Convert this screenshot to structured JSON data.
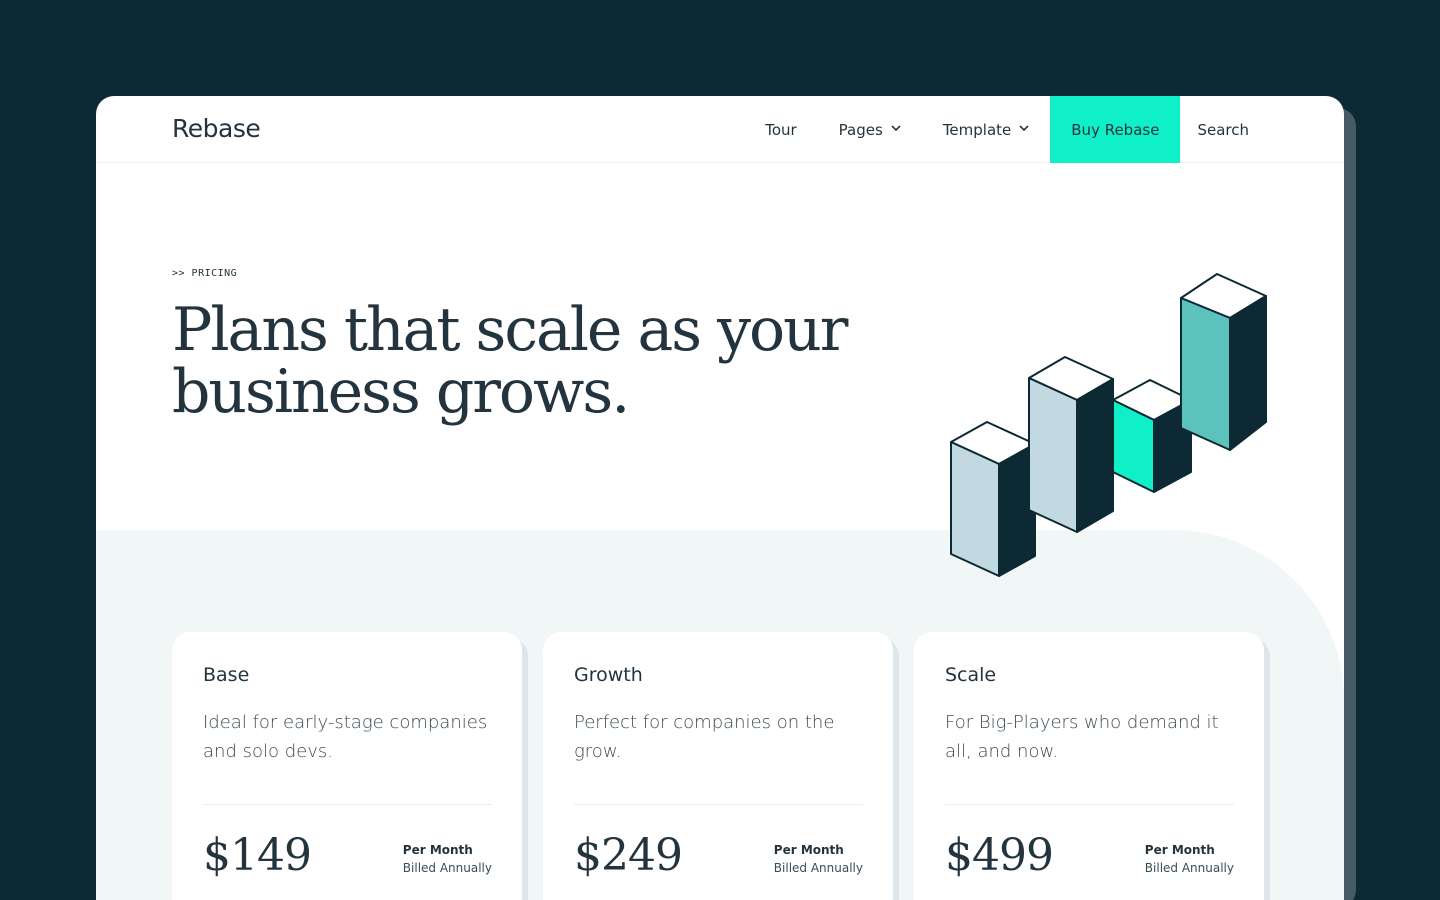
{
  "brand": {
    "name": "Rebase"
  },
  "nav": {
    "items": [
      {
        "label": "Tour",
        "dropdown": false
      },
      {
        "label": "Pages",
        "dropdown": true
      },
      {
        "label": "Template",
        "dropdown": true
      }
    ],
    "buy_label": "Buy Rebase",
    "search_label": "Search"
  },
  "hero": {
    "eyebrow": ">> PRICING",
    "headline": "Plans that scale as your business grows."
  },
  "plans": [
    {
      "name": "Base",
      "description": "Ideal for early-stage companies and solo devs.",
      "price": "$149",
      "period": "Per Month",
      "billing": "Billed Annually",
      "cta_color": "#12303a"
    },
    {
      "name": "Growth",
      "description": "Perfect for companies on the grow.",
      "price": "$249",
      "period": "Per Month",
      "billing": "Billed Annually",
      "cta_color": "#0ff0c8"
    },
    {
      "name": "Scale",
      "description": "For Big-Players who demand it all, and now.",
      "price": "$499",
      "period": "Per Month",
      "billing": "Billed Annually",
      "cta_color": "#12303a"
    }
  ],
  "colors": {
    "background": "#0d2933",
    "accent": "#0ff0c8",
    "dark": "#12303a",
    "light_blue": "#c2d9e2",
    "teal": "#5bc3bb"
  }
}
